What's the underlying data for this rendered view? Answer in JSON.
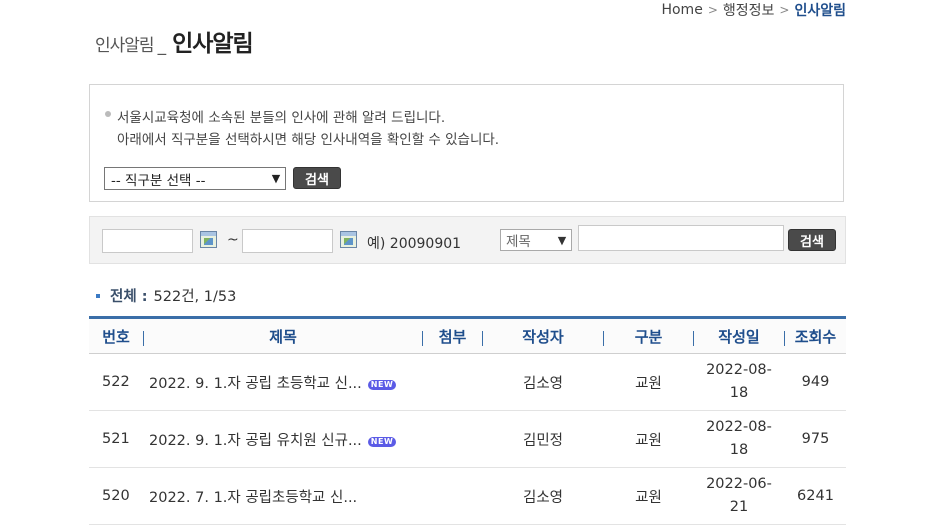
{
  "breadcrumb": {
    "home": "Home",
    "section": "행정정보",
    "current": "인사알림"
  },
  "page_title": {
    "sub": "인사알림",
    "main": "인사알림"
  },
  "notice": {
    "line1": "서울시교육청에 소속된 분들의 인사에 관해 알려 드립니다.",
    "line2": "아래에서 직구분을 선택하시면 해당 인사내역을 확인할 수 있습니다.",
    "select_value": "-- 직구분 선택 --",
    "search_button": "검색"
  },
  "filter": {
    "tilde": "~",
    "example": "예) 20090901",
    "field_select": "제목",
    "search_button": "검색",
    "start_date": "",
    "end_date": "",
    "keyword": ""
  },
  "summary": {
    "label": "전체 :",
    "value": "522건, 1/53"
  },
  "table": {
    "columns": [
      "번호",
      "제목",
      "첨부",
      "작성자",
      "구분",
      "작성일",
      "조회수"
    ],
    "rows": [
      {
        "no": "522",
        "title": "2022. 9. 1.자 공립 초등학교 신...",
        "badge": "NEW",
        "attach": "",
        "author": "김소영",
        "category": "교원",
        "date_line1": "2022-08-",
        "date_line2": "18",
        "views": "949"
      },
      {
        "no": "521",
        "title": "2022. 9. 1.자 공립 유치원 신규...",
        "badge": "NEW",
        "attach": "",
        "author": "김민정",
        "category": "교원",
        "date_line1": "2022-08-",
        "date_line2": "18",
        "views": "975"
      },
      {
        "no": "520",
        "title": "2022. 7. 1.자 공립초등학교 신...",
        "badge": "",
        "attach": "",
        "author": "김소영",
        "category": "교원",
        "date_line1": "2022-06-",
        "date_line2": "21",
        "views": "6241"
      }
    ]
  },
  "colors": {
    "accent": "#1f4e8c",
    "header_border": "#3a6ea8",
    "badge": "#5b5be6",
    "button": "#4a4a4a"
  }
}
